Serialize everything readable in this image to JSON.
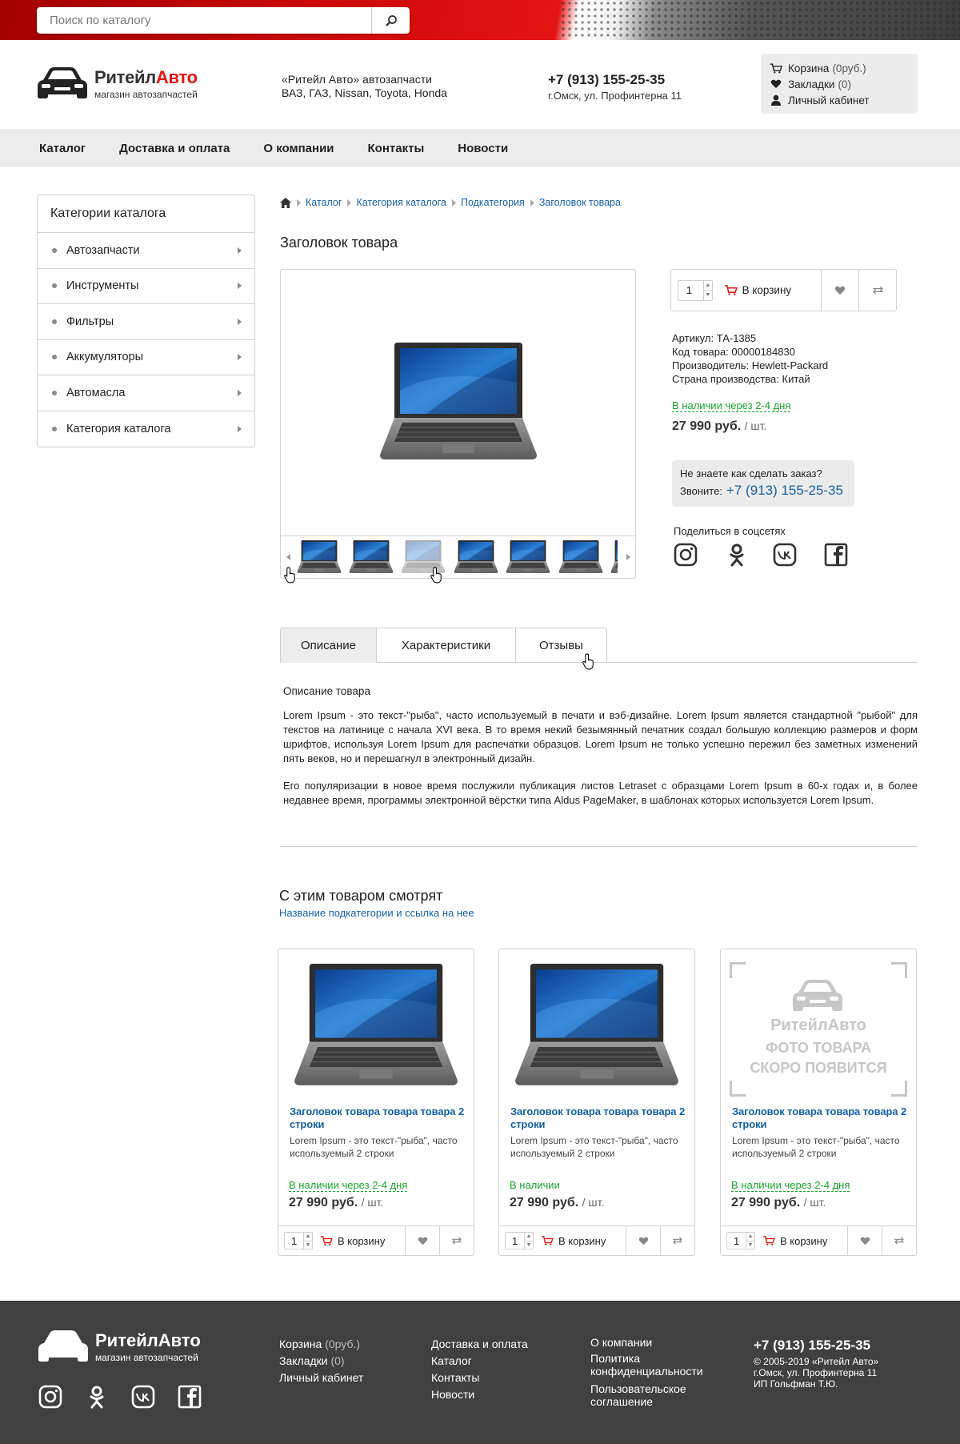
{
  "search": {
    "placeholder": "Поиск по каталогу"
  },
  "header": {
    "brand_part1": "Ритейл",
    "brand_part2": "Авто",
    "tagline": "магазин автозапчастей",
    "about_line1": "«Ритейл Авто» автозапчасти",
    "about_line2": "ВАЗ, ГАЗ, Nissan, Toyota, Honda",
    "phone": "+7 (913) 155-25-35",
    "address": "г.Омск, ул. Профинтерна 11"
  },
  "userbox": {
    "cart_label": "Корзина",
    "cart_value": "(0руб.)",
    "bookmarks_label": "Закладки",
    "bookmarks_value": "(0)",
    "account_label": "Личный кабинет"
  },
  "nav": [
    "Каталог",
    "Доставка и оплата",
    "О компании",
    "Контакты",
    "Новости"
  ],
  "sidebar": {
    "title": "Категории каталога",
    "items": [
      "Автозапчасти",
      "Инструменты",
      "Фильтры",
      "Аккумуляторы",
      "Автомасла",
      "Категория каталога"
    ]
  },
  "breadcrumb": [
    "Каталог",
    "Категория каталога",
    "Подкатегория",
    "Заголовок товара"
  ],
  "product": {
    "title": "Заголовок товара",
    "qty": "1",
    "add_to_cart": "В корзину",
    "sku": "Артикул: ТА-1385",
    "code": "Код товара: 00000184830",
    "manufacturer": "Производитель: Hewlett-Packard",
    "country": "Страна производства: Китай",
    "stock": "В наличии через 2-4 дня",
    "price": "27 990 руб.",
    "unit": "/ шт.",
    "help_question": "Не знаете как сделать заказ?",
    "help_call": "Звоните:",
    "help_phone": "+7 (913) 155-25-35",
    "share_label": "Поделиться в соцсетях"
  },
  "tabs": [
    "Описание",
    "Характеристики",
    "Отзывы"
  ],
  "description": {
    "title": "Описание товара",
    "p1": "Lorem Ipsum - это текст-\"рыба\", часто используемый в печати и вэб-дизайне. Lorem Ipsum является стандартной \"рыбой\" для текстов на латинице с начала XVI века. В то время некий безымянный печатник создал большую коллекцию размеров и форм шрифтов, используя Lorem Ipsum для распечатки образцов. Lorem Ipsum не только успешно пережил без заметных изменений пять веков, но и перешагнул в электронный дизайн.",
    "p2": "Его популяризации в новое время послужили публикация листов Letraset с образцами Lorem Ipsum в 60-х годах и, в более недавнее время, программы электронной вёрстки типа Aldus PageMaker, в шаблонах которых используется Lorem Ipsum."
  },
  "related": {
    "title": "С этим товаром смотрят",
    "subtitle": "Название подкатегории и ссылка на нее",
    "placeholder_brand": "РитейлАвто",
    "placeholder_l1": "ФОТО ТОВАРА",
    "placeholder_l2": "СКОРО ПОЯВИТСЯ",
    "cards": [
      {
        "name": "Заголовок товара товара товара 2 строки",
        "desc": "Lorem Ipsum - это текст-\"рыба\", часто используемый 2 строки",
        "stock": "В наличии через 2-4 дня",
        "price": "27 990 руб.",
        "unit": "/ шт.",
        "qty": "1",
        "cart": "В корзину"
      },
      {
        "name": "Заголовок товара товара товара 2 строки",
        "desc": "Lorem Ipsum - это текст-\"рыба\", часто используемый 2 строки",
        "stock": "В наличии",
        "price": "27 990 руб.",
        "unit": "/ шт.",
        "qty": "1",
        "cart": "В корзину"
      },
      {
        "name": "Заголовок товара товара товара 2 строки",
        "desc": "Lorem Ipsum - это текст-\"рыба\", часто используемый 2 строки",
        "stock": "В наличии через 2-4 дня",
        "price": "27 990 руб.",
        "unit": "/ шт.",
        "qty": "1",
        "cart": "В корзину"
      }
    ]
  },
  "footer": {
    "brand": "РитейлАвто",
    "tagline": "магазин автозапчастей",
    "col1": {
      "cart_label": "Корзина",
      "cart_value": "(0руб.)",
      "bookmarks_label": "Закладки",
      "bookmarks_value": "(0)",
      "account": "Личный кабинет"
    },
    "col2": [
      "Доставка и оплата",
      "Каталог",
      "Контакты",
      "Новости"
    ],
    "col3": [
      "О компании",
      "Политика конфиденциальности",
      "Пользовательское соглашение"
    ],
    "phone": "+7 (913) 155-25-35",
    "copyright": "© 2005-2019 «Ритейл Авто»",
    "address": "г.Омск, ул. Профинтерна 11",
    "owner": "ИП Гольфман Т.Ю."
  },
  "colors": {
    "brand_red": "#e31414",
    "link_blue": "#1561a8",
    "stock_green": "#1aa52a",
    "footer_bg": "#404040",
    "nav_bg": "#ededed"
  }
}
